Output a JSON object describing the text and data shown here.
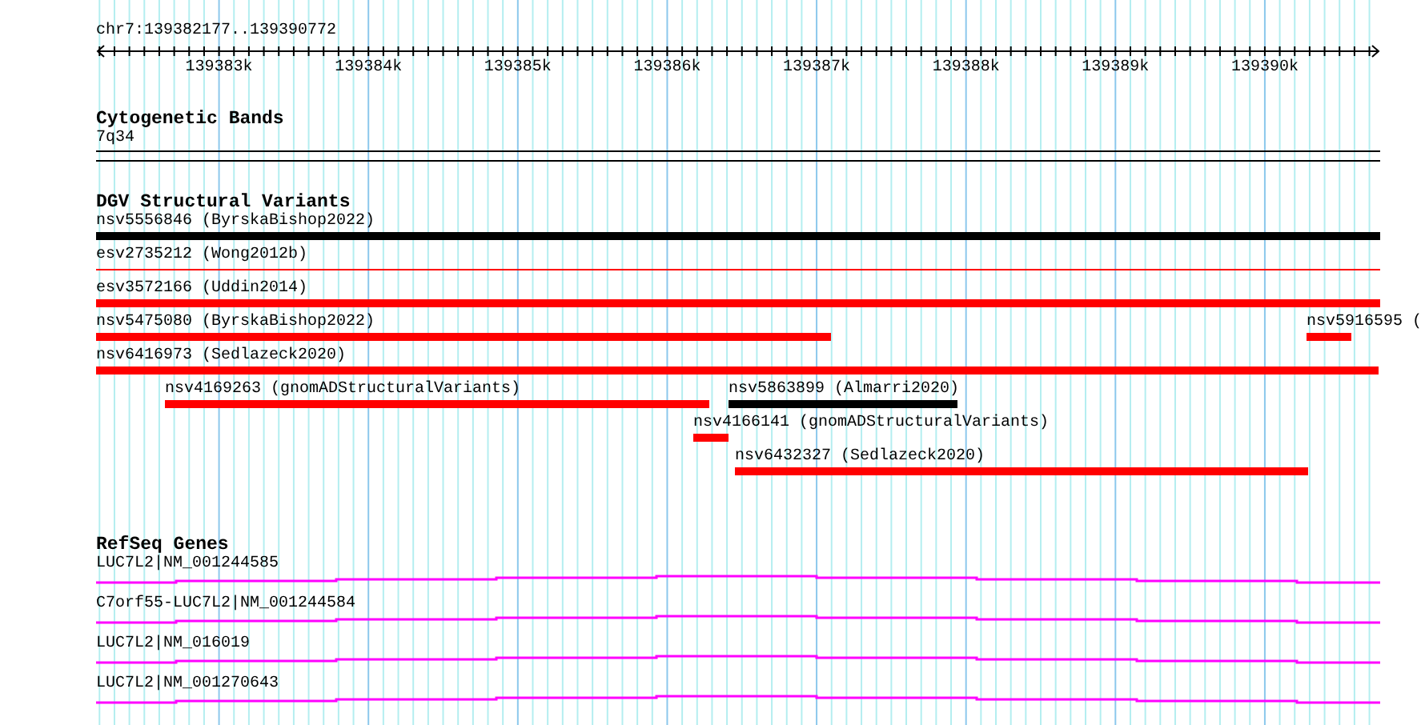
{
  "ruler": {
    "region": "chr7:139382177..139390772",
    "tick_labels": [
      "139383k",
      "139384k",
      "139385k",
      "139386k",
      "139387k",
      "139388k",
      "139389k",
      "139390k"
    ]
  },
  "cytogenetic_bands": {
    "title": "Cytogenetic Bands",
    "band": "7q34"
  },
  "dgv_structural_variants": {
    "title": "DGV Structural Variants",
    "features": [
      {
        "label": "nsv5556846 (ByrskaBishop2022)",
        "kind": "bar",
        "color": "#000000"
      },
      {
        "label": "esv2735212 (Wong2012b)",
        "kind": "line",
        "color": "#ff0000"
      },
      {
        "label": "esv3572166 (Uddin2014)",
        "kind": "bar",
        "color": "#ff0000"
      },
      {
        "label": "nsv5475080 (ByrskaBishop2022)",
        "kind": "bar",
        "color": "#ff0000"
      },
      {
        "label": "nsv5916595 (",
        "kind": "bar",
        "color": "#ff0000"
      },
      {
        "label": "nsv6416973 (Sedlazeck2020)",
        "kind": "bar",
        "color": "#ff0000"
      },
      {
        "label": "nsv4169263 (gnomADStructuralVariants)",
        "kind": "bar",
        "color": "#ff0000"
      },
      {
        "label": "nsv5863899 (Almarri2020)",
        "kind": "bar",
        "color": "#000000"
      },
      {
        "label": "nsv4166141 (gnomADStructuralVariants)",
        "kind": "bar",
        "color": "#ff0000"
      },
      {
        "label": "nsv6432327 (Sedlazeck2020)",
        "kind": "bar",
        "color": "#ff0000"
      }
    ]
  },
  "refseq_genes": {
    "title": "RefSeq Genes",
    "genes": [
      {
        "label": "LUC7L2|NM_001244585"
      },
      {
        "label": "C7orf55-LUC7L2|NM_001244584"
      },
      {
        "label": "LUC7L2|NM_016019"
      },
      {
        "label": "LUC7L2|NM_001270643"
      }
    ]
  }
}
